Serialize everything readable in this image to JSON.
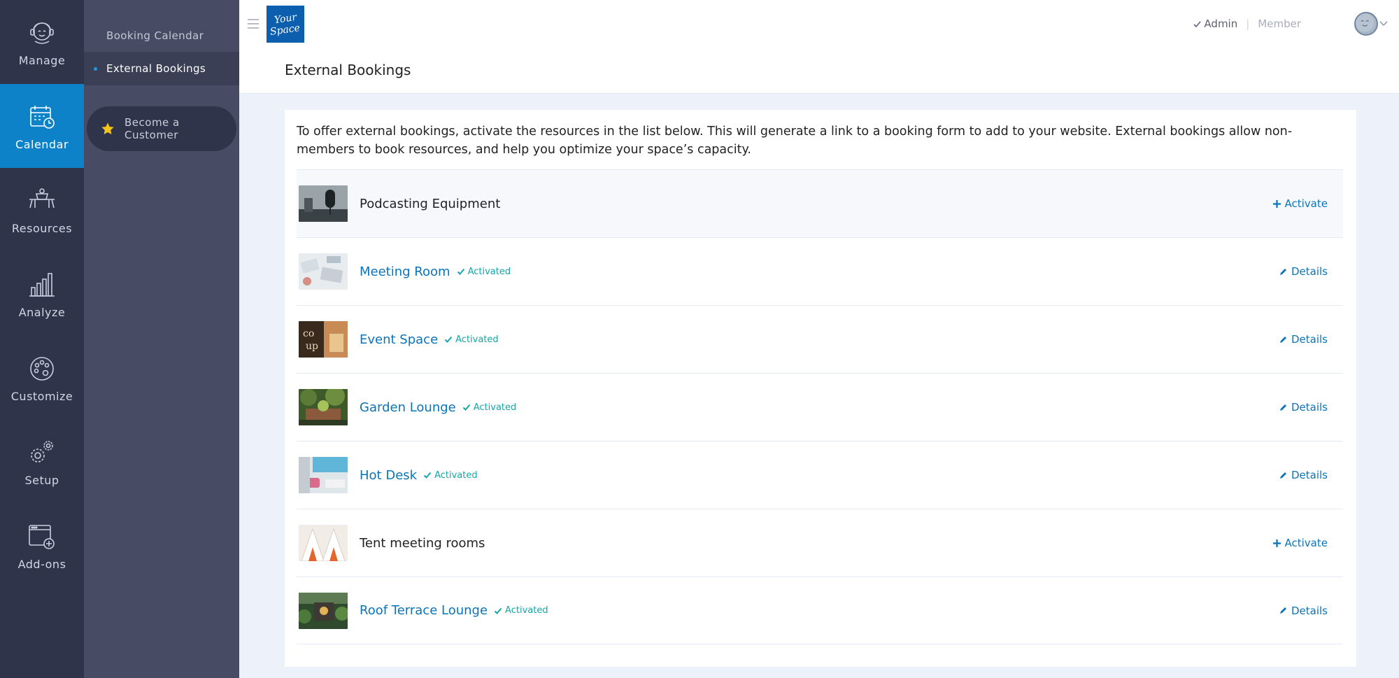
{
  "rail": {
    "items": [
      {
        "label": "Manage",
        "icon": "manage-icon"
      },
      {
        "label": "Calendar",
        "icon": "calendar-icon"
      },
      {
        "label": "Resources",
        "icon": "resources-icon"
      },
      {
        "label": "Analyze",
        "icon": "analyze-icon"
      },
      {
        "label": "Customize",
        "icon": "palette-icon"
      },
      {
        "label": "Setup",
        "icon": "gear-icon"
      },
      {
        "label": "Add-ons",
        "icon": "add-ons-icon"
      }
    ],
    "active": "Calendar"
  },
  "subnav": {
    "items": [
      {
        "label": "Booking Calendar"
      },
      {
        "label": "External Bookings"
      }
    ],
    "become_customer": "Become a Customer"
  },
  "header": {
    "logo_line1": "Your",
    "logo_line2": "Space",
    "page_title": "External Bookings",
    "role_admin": "Admin",
    "role_separator": "|",
    "role_member": "Member"
  },
  "main": {
    "intro": "To offer external bookings, activate the resources in the list below. This will generate a link to a booking form to add to your website. External bookings allow non-members to book resources, and help you optimize your space’s capacity.",
    "activated_label": "Activated",
    "resources": [
      {
        "name": "Podcasting Equipment",
        "activated": false,
        "action": "Activate"
      },
      {
        "name": "Meeting Room",
        "activated": true,
        "action": "Details"
      },
      {
        "name": "Event Space",
        "activated": true,
        "action": "Details"
      },
      {
        "name": "Garden Lounge",
        "activated": true,
        "action": "Details"
      },
      {
        "name": "Hot Desk",
        "activated": true,
        "action": "Details"
      },
      {
        "name": "Tent meeting rooms",
        "activated": false,
        "action": "Activate"
      },
      {
        "name": "Roof Terrace Lounge",
        "activated": true,
        "action": "Details"
      }
    ]
  },
  "colors": {
    "rail_bg": "#30344b",
    "rail_active": "#0d82c8",
    "subnav_bg": "#474b63",
    "link": "#0b74b8",
    "activated": "#14a7a6",
    "logo_bg": "#0b5fae"
  }
}
